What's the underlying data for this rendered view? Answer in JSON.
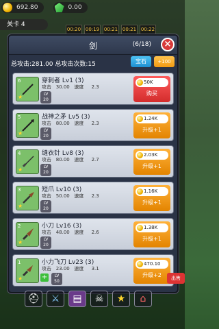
{
  "topbar": {
    "coins": "692.80",
    "gems": "0.00"
  },
  "level": "关卡 4",
  "timers": [
    "00:20",
    "00:19",
    "00:21",
    "00:21",
    "00:22"
  ],
  "panel": {
    "title": "剑",
    "count": "(6/18)",
    "close": "×",
    "summary": "总攻击:281.00  总攻击次数:15",
    "gem_button": "宝石",
    "plus_button": "+100"
  },
  "weapons": [
    {
      "num": "6",
      "name": "穿刺者 Lv1 (3)",
      "atk_label": "攻击",
      "atk": "30.00",
      "spd_label": "速度",
      "spd": "2.3",
      "lv": "LV",
      "lv_num": "20",
      "price": "50K",
      "action": "购买",
      "type": "buy"
    },
    {
      "num": "5",
      "name": "战神之矛 Lv5 (3)",
      "atk_label": "攻击",
      "atk": "80.00",
      "spd_label": "速度",
      "spd": "2.3",
      "lv": "LV",
      "lv_num": "20",
      "price": "1.24K",
      "action": "升级+1",
      "type": "up"
    },
    {
      "num": "4",
      "name": "缝衣针 Lv8 (3)",
      "atk_label": "攻击",
      "atk": "80.00",
      "spd_label": "速度",
      "spd": "2.7",
      "lv": "LV",
      "lv_num": "20",
      "price": "2.03K",
      "action": "升级+1",
      "type": "up"
    },
    {
      "num": "3",
      "name": "短爪 Lv10 (3)",
      "atk_label": "攻击",
      "atk": "50.00",
      "spd_label": "速度",
      "spd": "2.3",
      "lv": "LV",
      "lv_num": "20",
      "price": "1.16K",
      "action": "升级+1",
      "type": "up"
    },
    {
      "num": "2",
      "name": "小刀 Lv16 (3)",
      "atk_label": "攻击",
      "atk": "48.00",
      "spd_label": "速度",
      "spd": "2.6",
      "lv": "LV",
      "lv_num": "20",
      "price": "1.38K",
      "action": "升级+1",
      "type": "up"
    },
    {
      "num": "1",
      "name": "小力飞刀 Lv23 (3)",
      "atk_label": "攻击",
      "atk": "23.00",
      "spd_label": "速度",
      "spd": "3.1",
      "lv": "LV",
      "lv_num": "50",
      "price": "470.10",
      "action": "升级+2",
      "type": "up"
    }
  ],
  "side_button": "出售",
  "bottom_icons": [
    "helmet-icon",
    "sword-icon",
    "book-icon",
    "skull-icon",
    "star-icon",
    "shop-icon"
  ]
}
